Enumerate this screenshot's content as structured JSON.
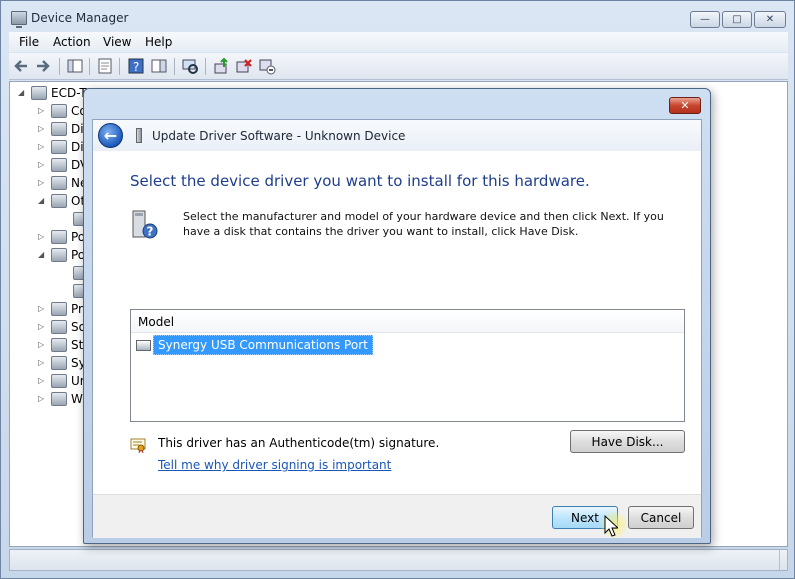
{
  "window": {
    "title": "Device Manager",
    "minimize_glyph": "—",
    "maximize_glyph": "□",
    "close_glyph": "✕"
  },
  "menu": [
    {
      "label": "File"
    },
    {
      "label": "Action"
    },
    {
      "label": "View"
    },
    {
      "label": "Help"
    }
  ],
  "toolbar_icons": [
    "back-arrow-icon",
    "forward-arrow-icon",
    "show-hide-console-tree-icon",
    "properties-icon",
    "help-icon",
    "action-pane-icon",
    "scan-hardware-icon",
    "update-driver-icon",
    "uninstall-icon",
    "disable-device-icon"
  ],
  "tree": {
    "root": "ECD-T",
    "items": [
      {
        "label": "Co",
        "icon": "computer-icon"
      },
      {
        "label": "Di",
        "icon": "disk-drive-icon"
      },
      {
        "label": "Di",
        "icon": "display-adapter-icon"
      },
      {
        "label": "DV",
        "icon": "dvd-drive-icon"
      },
      {
        "label": "Ne",
        "icon": "network-adapter-icon"
      },
      {
        "label": "Ot",
        "icon": "other-devices-icon"
      },
      {
        "label": "",
        "icon": "unknown-device-icon"
      },
      {
        "label": "Po",
        "icon": "portable-devices-icon"
      },
      {
        "label": "Po",
        "icon": "ports-icon"
      },
      {
        "label": "",
        "icon": "port-icon"
      },
      {
        "label": "",
        "icon": "port-icon"
      },
      {
        "label": "Pr",
        "icon": "processor-icon"
      },
      {
        "label": "So",
        "icon": "sound-icon"
      },
      {
        "label": "St",
        "icon": "storage-controller-icon"
      },
      {
        "label": "Sy",
        "icon": "system-devices-icon"
      },
      {
        "label": "Ur",
        "icon": "usb-controller-icon"
      },
      {
        "label": "W",
        "icon": "printer-icon"
      }
    ]
  },
  "dialog": {
    "title": "Update Driver Software - Unknown Device",
    "close_glyph": "✕",
    "back_glyph": "←",
    "heading": "Select the device driver you want to install for this hardware.",
    "description": "Select the manufacturer and model of your hardware device and then click Next. If you have a disk that contains the driver you want to install, click Have Disk.",
    "model_header": "Model",
    "models": [
      {
        "label": "Synergy USB Communications Port",
        "selected": true
      }
    ],
    "signature_text": "This driver has an Authenticode(tm) signature.",
    "signing_link": "Tell me why driver signing is important",
    "have_disk_label": "Have Disk...",
    "next_label": "Next",
    "cancel_label": "Cancel"
  },
  "colors": {
    "heading_blue": "#1e3e8c",
    "link_blue": "#1a56b8",
    "selection_blue": "#3399ff",
    "close_red": "#c8452e"
  }
}
